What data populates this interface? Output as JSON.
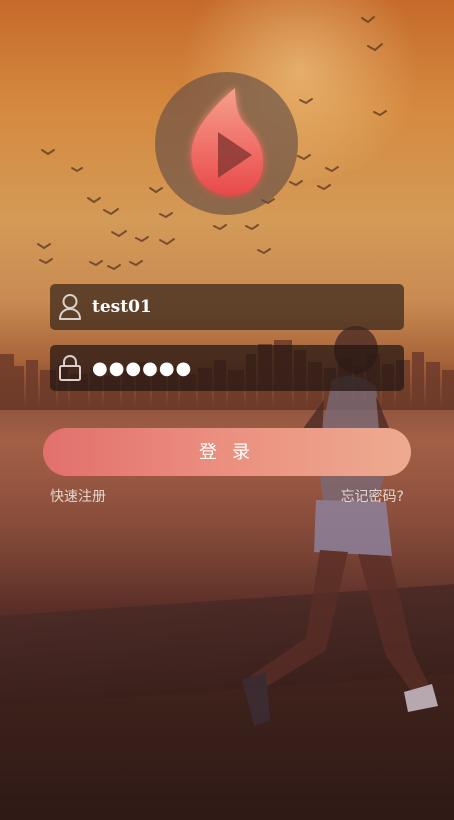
{
  "login_form": {
    "username_value": "test01",
    "password_masked": "●●●●●●",
    "login_label": "登 录",
    "register_link": "快速注册",
    "forgot_link": "忘记密码?"
  },
  "icons": {
    "logo": "flame-play-logo-icon",
    "username": "user-icon",
    "password": "lock-icon"
  },
  "colors": {
    "button_start": "#e2706c",
    "button_end": "#eeaa90",
    "logo_start": "#f07a70",
    "logo_end": "#e9504c",
    "text_light": "#e4d6cf"
  }
}
